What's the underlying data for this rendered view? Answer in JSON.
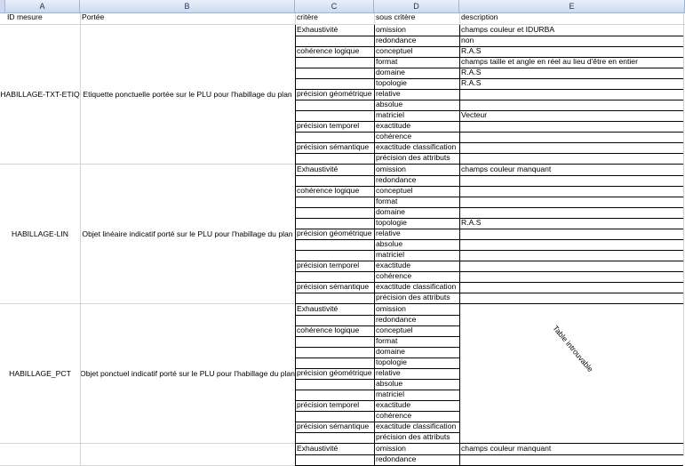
{
  "columns": [
    "A",
    "B",
    "C",
    "D",
    "E"
  ],
  "header_row": {
    "id": "ID mesure",
    "portee": "Portée",
    "critere": "critère",
    "sous_critere": "sous critère",
    "description": "description"
  },
  "groups": [
    {
      "id": "HABILLAGE-TXT-ETIQ",
      "portee": "Etiquette ponctuelle portée sur le PLU pour l'habillage du plan",
      "rows": [
        {
          "critere": "Exhaustivité",
          "sous": "omission",
          "desc": "champs couleur et IDURBA"
        },
        {
          "critere": "",
          "sous": "redondance",
          "desc": "non"
        },
        {
          "critere": "cohérence logique",
          "sous": "conceptuel",
          "desc": "R.A.S"
        },
        {
          "critere": "",
          "sous": "format",
          "desc": "champs taille et angle en réel au lieu d'être en entier"
        },
        {
          "critere": "",
          "sous": "domaine",
          "desc": "R.A.S"
        },
        {
          "critere": "",
          "sous": "topologie",
          "desc": "R.A.S"
        },
        {
          "critere": "précision géométrique",
          "sous": "relative",
          "desc": ""
        },
        {
          "critere": "",
          "sous": "absolue",
          "desc": ""
        },
        {
          "critere": "",
          "sous": "matriciel",
          "desc": "Vecteur"
        },
        {
          "critere": "précision temporel",
          "sous": "exactitude",
          "desc": ""
        },
        {
          "critere": "",
          "sous": "cohérence",
          "desc": ""
        },
        {
          "critere": "précision sémantique",
          "sous": "exactitude classification",
          "desc": ""
        },
        {
          "critere": "",
          "sous": "précision des attributs",
          "desc": ""
        }
      ]
    },
    {
      "id": "HABILLAGE-LIN",
      "portee": "Objet linéaire indicatif porté sur le PLU pour l'habillage du plan",
      "rows": [
        {
          "critere": "Exhaustivité",
          "sous": "omission",
          "desc": "champs couleur manquant"
        },
        {
          "critere": "",
          "sous": "redondance",
          "desc": ""
        },
        {
          "critere": "cohérence logique",
          "sous": "conceptuel",
          "desc": ""
        },
        {
          "critere": "",
          "sous": "format",
          "desc": ""
        },
        {
          "critere": "",
          "sous": "domaine",
          "desc": ""
        },
        {
          "critere": "",
          "sous": "topologie",
          "desc": "R.A.S"
        },
        {
          "critere": "précision géométrique",
          "sous": "relative",
          "desc": ""
        },
        {
          "critere": "",
          "sous": "absolue",
          "desc": ""
        },
        {
          "critere": "",
          "sous": "matriciel",
          "desc": ""
        },
        {
          "critere": "précision temporel",
          "sous": "exactitude",
          "desc": ""
        },
        {
          "critere": "",
          "sous": "cohérence",
          "desc": ""
        },
        {
          "critere": "précision sémantique",
          "sous": "exactitude classification",
          "desc": ""
        },
        {
          "critere": "",
          "sous": "précision des attributs",
          "desc": ""
        }
      ]
    },
    {
      "id": "HABILLAGE_PCT",
      "portee": "Objet ponctuel indicatif porté sur le PLU pour l'habillage du plan",
      "rows": [
        {
          "critere": "Exhaustivité",
          "sous": "omission",
          "desc": ""
        },
        {
          "critere": "",
          "sous": "redondance",
          "desc": ""
        },
        {
          "critere": "cohérence logique",
          "sous": "conceptuel",
          "desc": ""
        },
        {
          "critere": "",
          "sous": "format",
          "desc": ""
        },
        {
          "critere": "",
          "sous": "domaine",
          "desc": ""
        },
        {
          "critere": "",
          "sous": "topologie",
          "desc": ""
        },
        {
          "critere": "précision géométrique",
          "sous": "relative",
          "desc": ""
        },
        {
          "critere": "",
          "sous": "absolue",
          "desc": ""
        },
        {
          "critere": "",
          "sous": "matriciel",
          "desc": ""
        },
        {
          "critere": "précision temporel",
          "sous": "exactitude",
          "desc": ""
        },
        {
          "critere": "",
          "sous": "cohérence",
          "desc": ""
        },
        {
          "critere": "précision sémantique",
          "sous": "exactitude classification",
          "desc": ""
        },
        {
          "critere": "",
          "sous": "précision des attributs",
          "desc": ""
        }
      ],
      "merged_note": "Table introuvable"
    },
    {
      "id": "",
      "portee": "",
      "rows": [
        {
          "critere": "Exhaustivité",
          "sous": "omission",
          "desc": "champs couleur manquant"
        },
        {
          "critere": "",
          "sous": "redondance",
          "desc": ""
        }
      ]
    }
  ]
}
